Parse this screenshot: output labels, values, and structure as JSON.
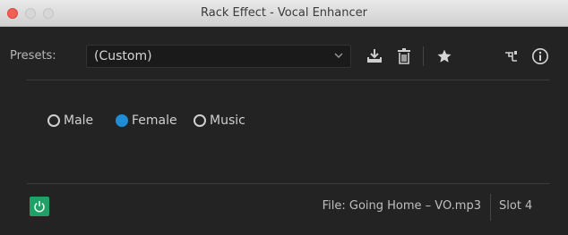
{
  "window": {
    "title": "Rack Effect - Vocal Enhancer"
  },
  "presets": {
    "label": "Presets:",
    "selected": "(Custom)",
    "icons": [
      "download-icon",
      "trash-icon",
      "star-icon",
      "routing-icon",
      "info-icon"
    ]
  },
  "mode": {
    "options": [
      {
        "label": "Male",
        "selected": false
      },
      {
        "label": "Female",
        "selected": true
      },
      {
        "label": "Music",
        "selected": false
      }
    ]
  },
  "status": {
    "file": "File: Going Home – VO.mp3",
    "slot": "Slot 4"
  },
  "colors": {
    "accent": "#1f8dd6",
    "power": "#1fa066",
    "background": "#232323"
  }
}
